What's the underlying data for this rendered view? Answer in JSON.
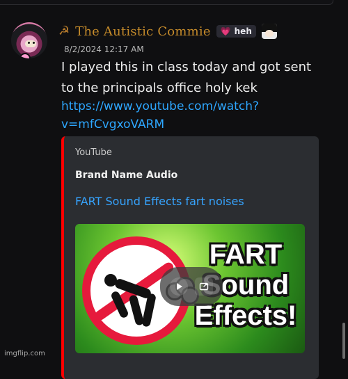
{
  "message": {
    "author_prefix_symbol": "☭",
    "author_name": "The Autistic Commie",
    "tag_icon": "heart",
    "tag_text": "heh",
    "timestamp": "8/2/2024 12:17 AM",
    "body_text": "I played this in class today and got sent to the principals office holy kek",
    "link_text": "https://www.youtube.com/watch?v=mfCvgxoVARM"
  },
  "embed": {
    "provider": "YouTube",
    "author": "Brand Name Audio",
    "title": "FART Sound Effects fart noises",
    "thumbnail_text": [
      "FART",
      "Sound",
      "Effects!"
    ],
    "accent_color": "#ff0000",
    "link_color": "#36a4ff"
  },
  "watermark": "imgflip.com"
}
